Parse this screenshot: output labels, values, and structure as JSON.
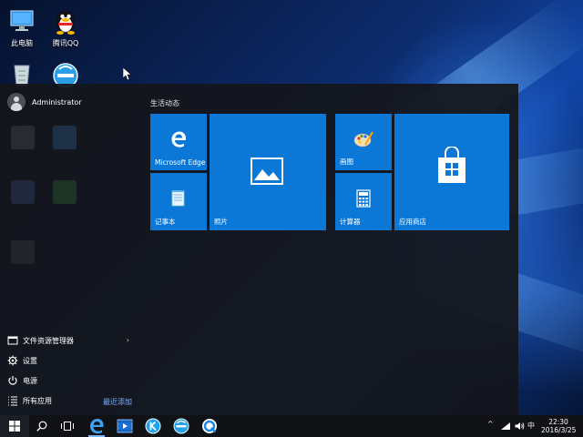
{
  "desktop": {
    "icons": [
      {
        "label": "此电脑",
        "icon": "computer-icon"
      },
      {
        "label": "腾讯QQ",
        "icon": "qq-penguin-icon"
      },
      {
        "label": "",
        "icon": "recycle-bin-icon"
      },
      {
        "label": "",
        "icon": "browser-icon"
      }
    ]
  },
  "start_menu": {
    "user_name": "Administrator",
    "items": [
      {
        "label": "文件资源管理器",
        "icon": "file-explorer-icon"
      },
      {
        "label": "设置",
        "icon": "gear-icon"
      },
      {
        "label": "电源",
        "icon": "power-icon"
      },
      {
        "label": "所有应用",
        "icon": "all-apps-icon"
      }
    ],
    "recent_link": "最近添加",
    "group_title": "生活动态",
    "tiles": [
      {
        "label": "Microsoft Edge",
        "icon": "edge-icon"
      },
      {
        "label": "照片",
        "icon": "photos-icon"
      },
      {
        "label": "记事本",
        "icon": "notepad-icon"
      },
      {
        "label": "画图",
        "icon": "paint-icon"
      },
      {
        "label": "应用商店",
        "icon": "store-icon"
      },
      {
        "label": "计算器",
        "icon": "calculator-icon"
      }
    ],
    "tile_color": "#0b78d7"
  },
  "taskbar": {
    "time": "22:30",
    "date": "2016/3/25",
    "ime": "中",
    "apps": [
      "start-icon",
      "search-icon",
      "task-view-icon",
      "edge-icon",
      "media-player-icon",
      "k-app-icon",
      "browser-icon",
      "qq-browser-icon"
    ]
  }
}
